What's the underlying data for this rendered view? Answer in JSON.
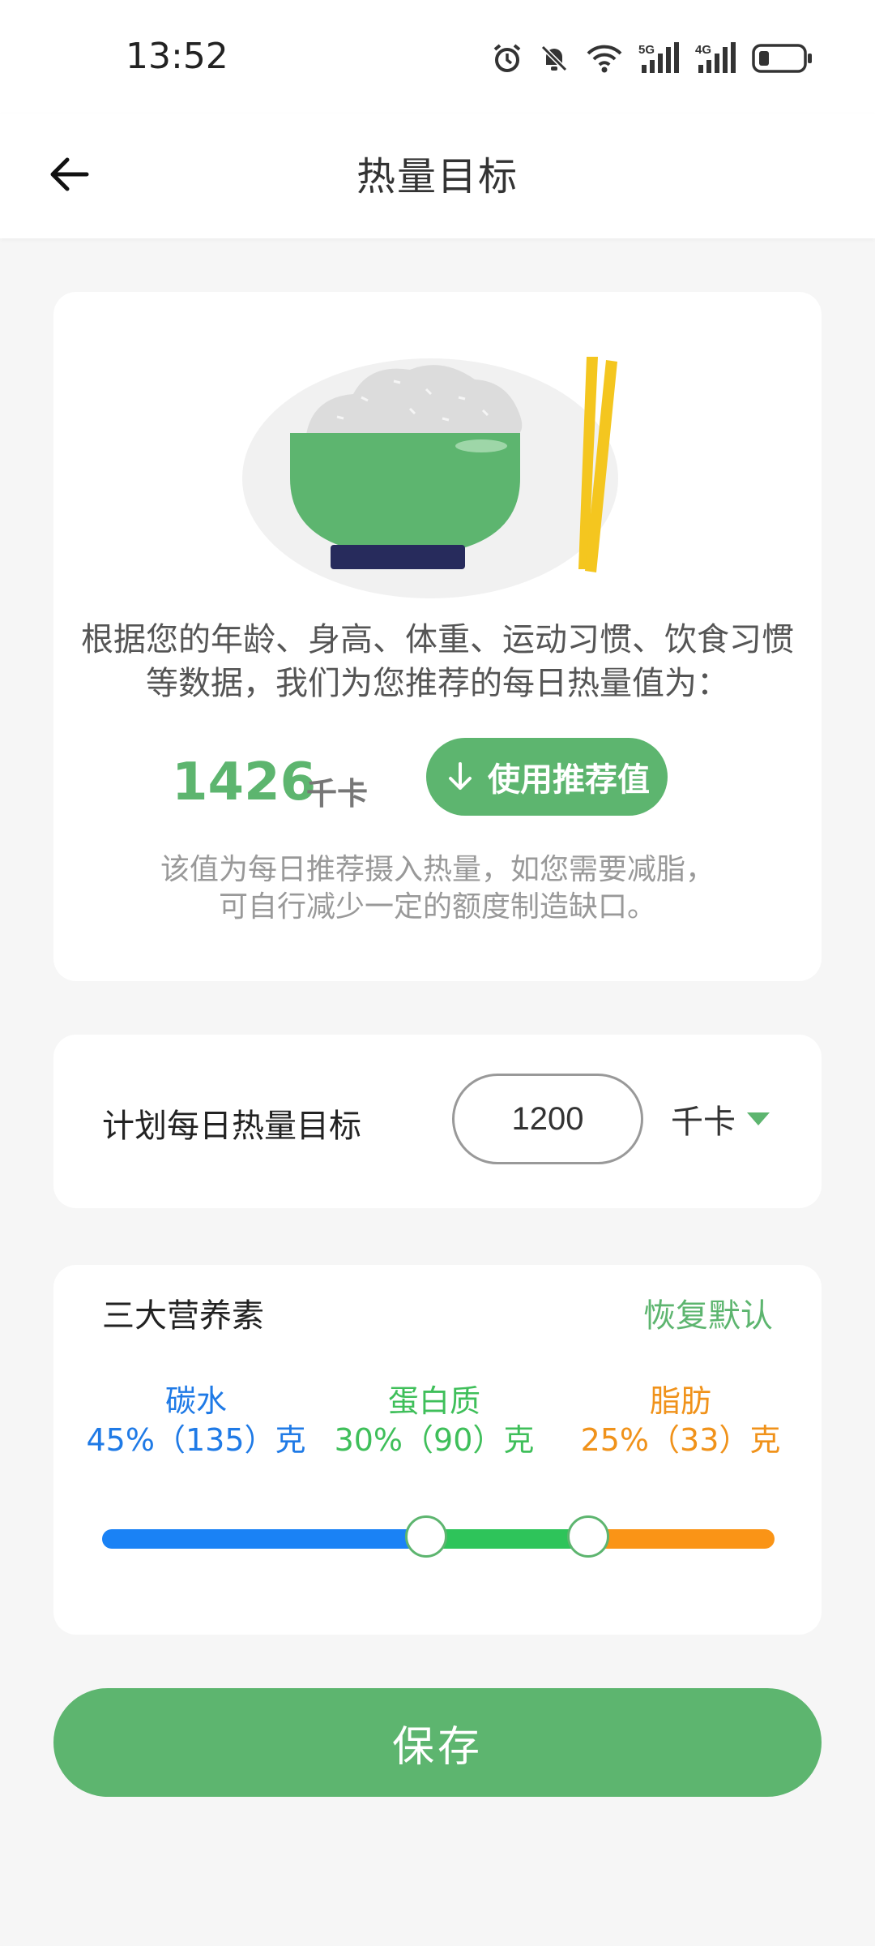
{
  "status_bar": {
    "time": "13:52",
    "icons": [
      "alarm-icon",
      "mute-bell-icon",
      "wifi-icon",
      "signal-5g-icon",
      "signal-4g-icon",
      "battery-icon"
    ],
    "network_5g": "5G",
    "network_4g": "4G"
  },
  "header": {
    "title": "热量目标",
    "back_icon": "back-arrow-icon"
  },
  "recommend": {
    "description": "根据您的年龄、身高、体重、运动习惯、饮食习惯等数据，我们为您推荐的每日热量值为：",
    "value": "1426",
    "unit": "千卡",
    "use_button": "使用推荐值",
    "hint_line1": "该值为每日推荐摄入热量，如您需要减脂，",
    "hint_line2": "可自行减少一定的额度制造缺口。"
  },
  "target": {
    "label": "计划每日热量目标",
    "value": "1200",
    "unit": "千卡"
  },
  "macros": {
    "title": "三大营养素",
    "restore": "恢复默认",
    "carb": {
      "name": "碳水",
      "detail": "45%（135）克",
      "color": "#1f7ae6",
      "percent": 45
    },
    "protein": {
      "name": "蛋白质",
      "detail": "30%（90）克",
      "color": "#3fbf5a",
      "percent": 30
    },
    "fat": {
      "name": "脂肪",
      "detail": "25%（33）克",
      "color": "#f0921a",
      "percent": 25
    }
  },
  "save_button": "保存",
  "colors": {
    "accent": "#5db56f",
    "background": "#f6f6f6"
  }
}
